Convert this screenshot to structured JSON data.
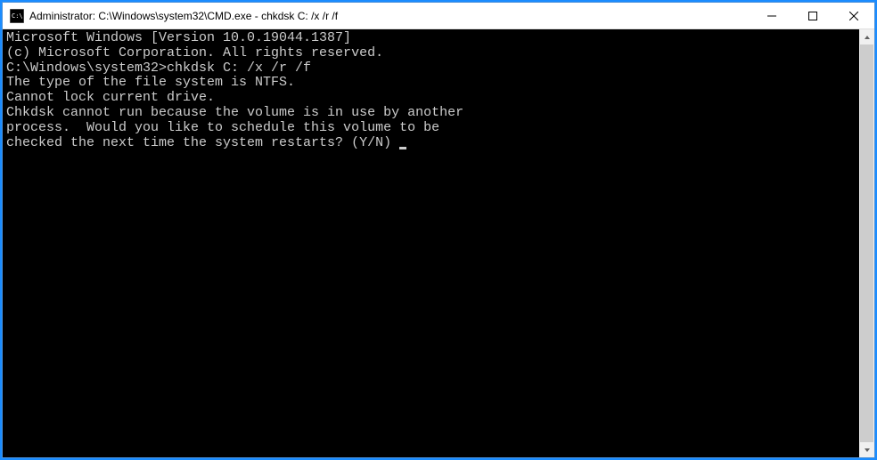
{
  "window": {
    "title": "Administrator: C:\\Windows\\system32\\CMD.exe - chkdsk  C: /x /r /f"
  },
  "terminal": {
    "lines": [
      "Microsoft Windows [Version 10.0.19044.1387]",
      "(c) Microsoft Corporation. All rights reserved.",
      "",
      "C:\\Windows\\system32>chkdsk C: /x /r /f",
      "The type of the file system is NTFS.",
      "Cannot lock current drive.",
      "",
      "Chkdsk cannot run because the volume is in use by another",
      "process.  Would you like to schedule this volume to be",
      "checked the next time the system restarts? (Y/N) "
    ]
  }
}
